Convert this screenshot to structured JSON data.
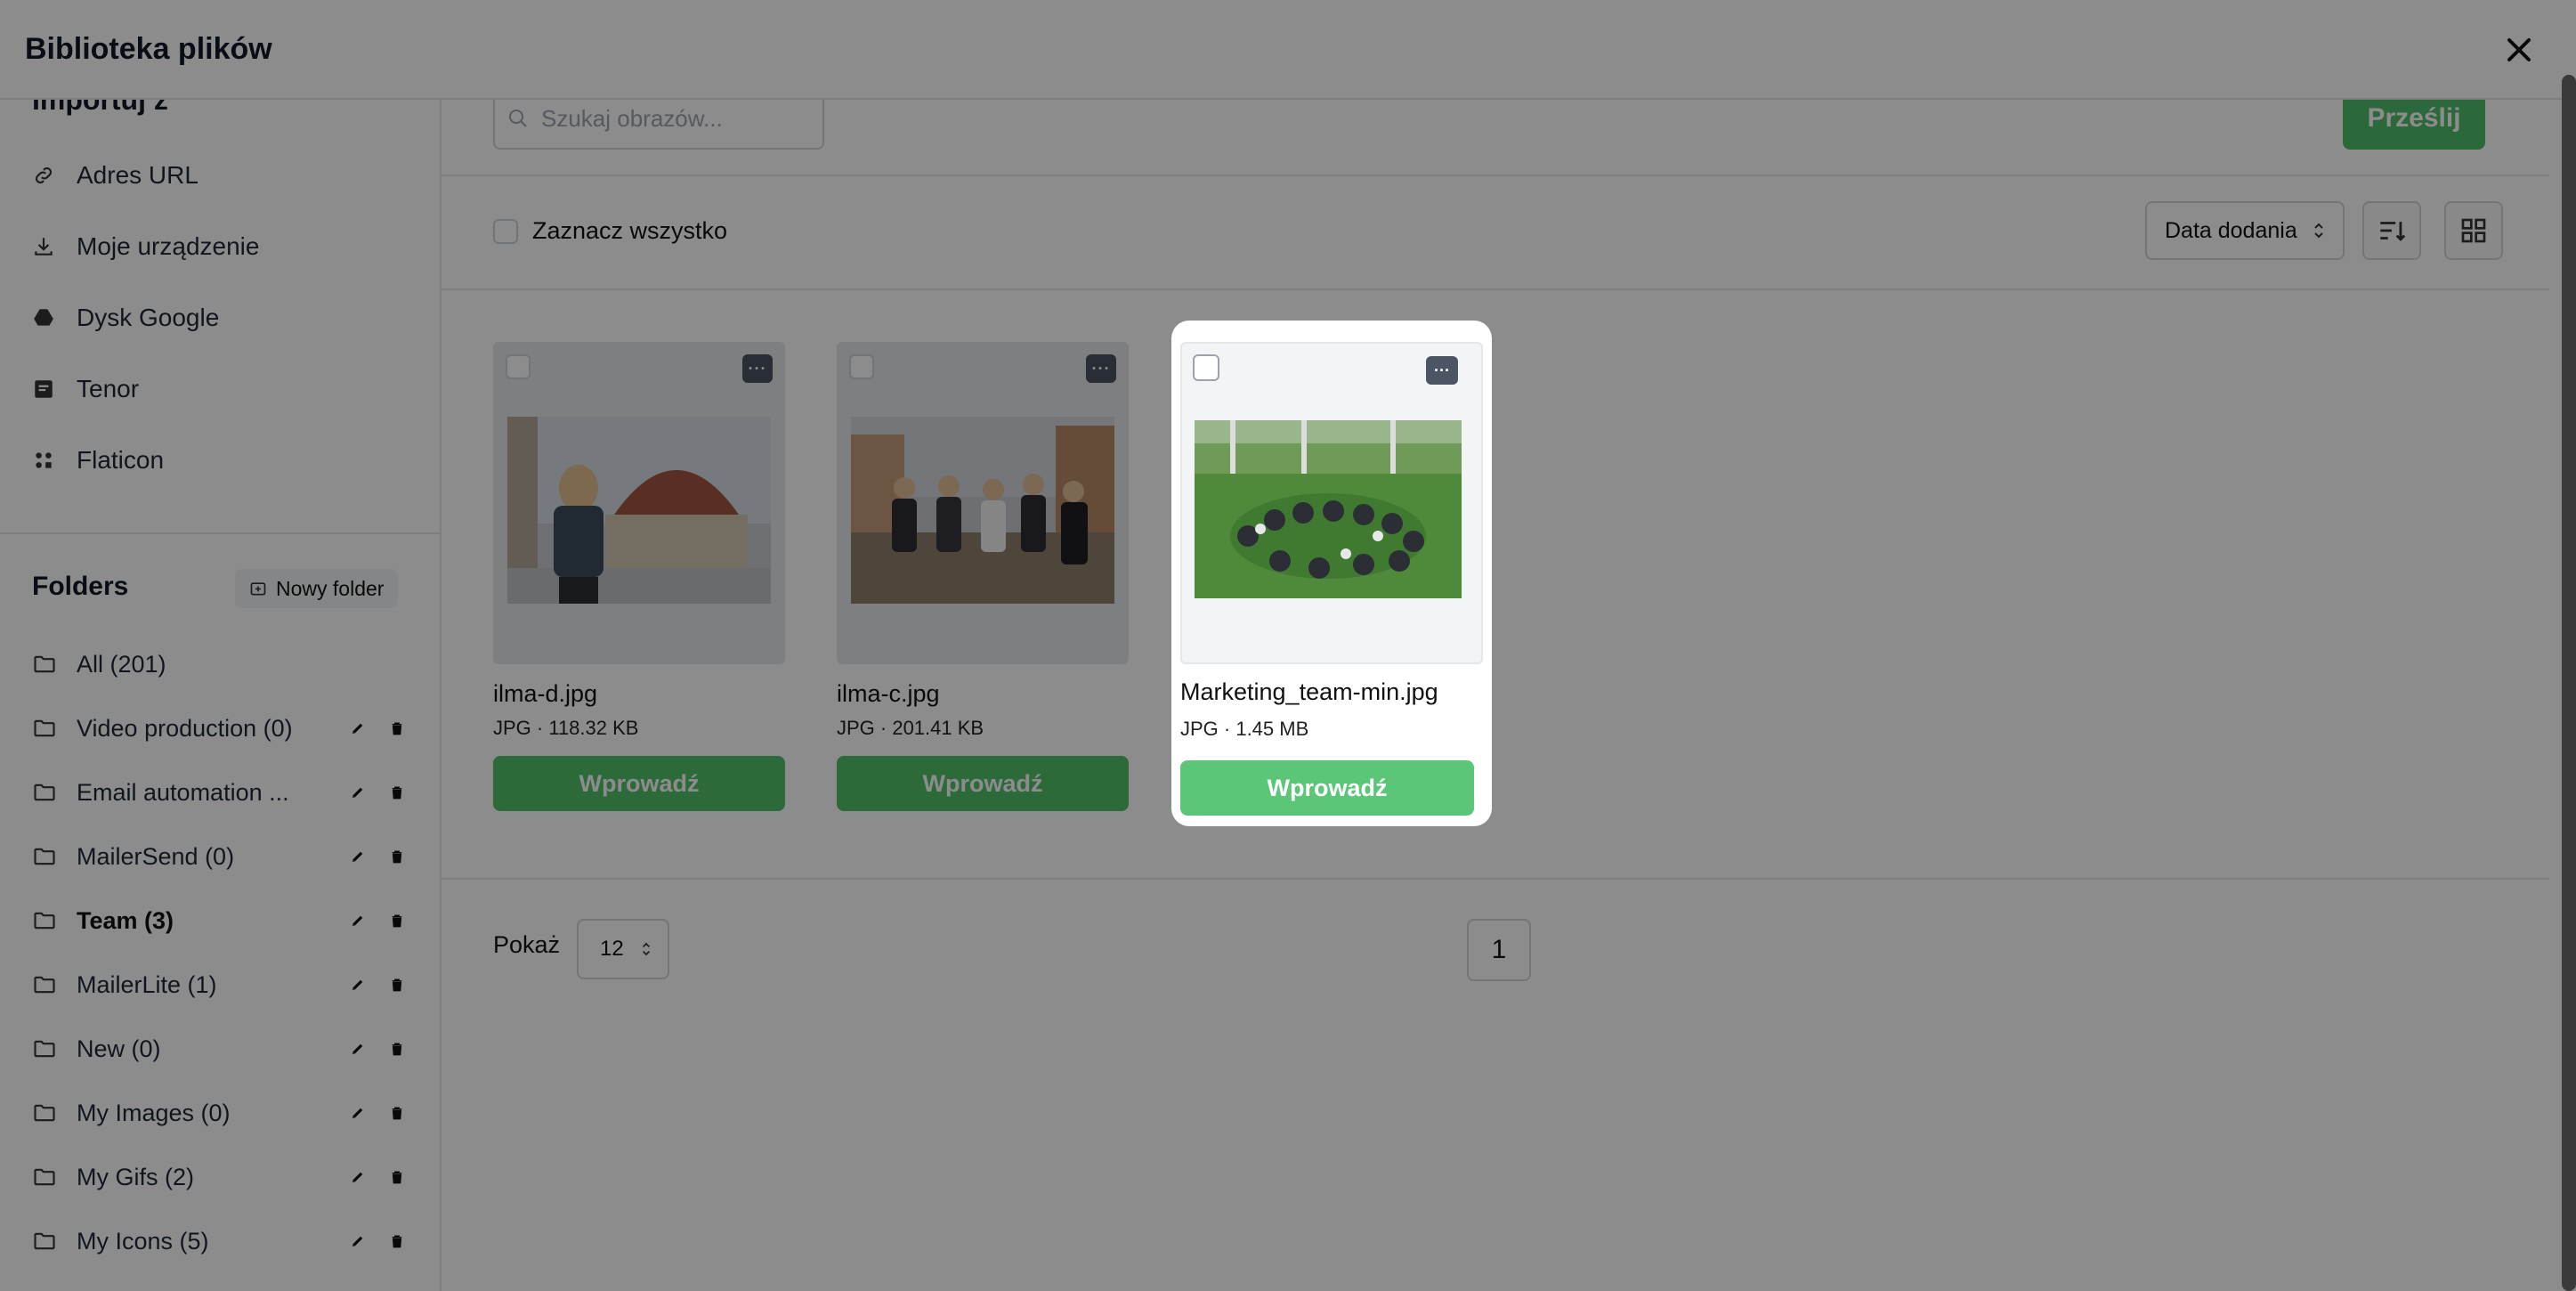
{
  "modal": {
    "title": "Biblioteka plików"
  },
  "sidebar": {
    "cut_heading": "Importuj z",
    "sources": [
      {
        "label": "Adres URL",
        "icon": "link-icon"
      },
      {
        "label": "Moje urządzenie",
        "icon": "download-icon"
      },
      {
        "label": "Dysk Google",
        "icon": "google-drive-icon"
      },
      {
        "label": "Tenor",
        "icon": "tenor-icon"
      },
      {
        "label": "Flaticon",
        "icon": "flaticon-icon"
      }
    ],
    "folders_title": "Folders",
    "new_folder_label": "Nowy folder",
    "folders": [
      {
        "label": "All (201)",
        "actions": false
      },
      {
        "label": "Video production (0)",
        "actions": true
      },
      {
        "label": "Email automation ...",
        "actions": true
      },
      {
        "label": "MailerSend (0)",
        "actions": true
      },
      {
        "label": "Team (3)",
        "actions": true,
        "active": true
      },
      {
        "label": "MailerLite (1)",
        "actions": true
      },
      {
        "label": "New (0)",
        "actions": true
      },
      {
        "label": "My Images (0)",
        "actions": true
      },
      {
        "label": "My Gifs (2)",
        "actions": true
      },
      {
        "label": "My Icons (5)",
        "actions": true
      }
    ]
  },
  "toolbar": {
    "search_placeholder": "Szukaj obrazów...",
    "upload_label": "Prześlij",
    "select_all_label": "Zaznacz wszystko",
    "sort_label": "Data dodania"
  },
  "files": [
    {
      "name": "ilma-d.jpg",
      "meta": "JPG · 118.32 KB",
      "insert_label": "Wprowadź"
    },
    {
      "name": "ilma-c.jpg",
      "meta": "JPG · 201.41 KB",
      "insert_label": "Wprowadź"
    },
    {
      "name": "Marketing_team-min.jpg",
      "meta": "JPG · 1.45 MB",
      "insert_label": "Wprowadź"
    }
  ],
  "pagination": {
    "show_label": "Pokaż",
    "per_page": "12",
    "current_page": "1"
  },
  "colors": {
    "accent_green": "#50c26b",
    "overlay": "rgba(0,0,0,0.45)"
  }
}
